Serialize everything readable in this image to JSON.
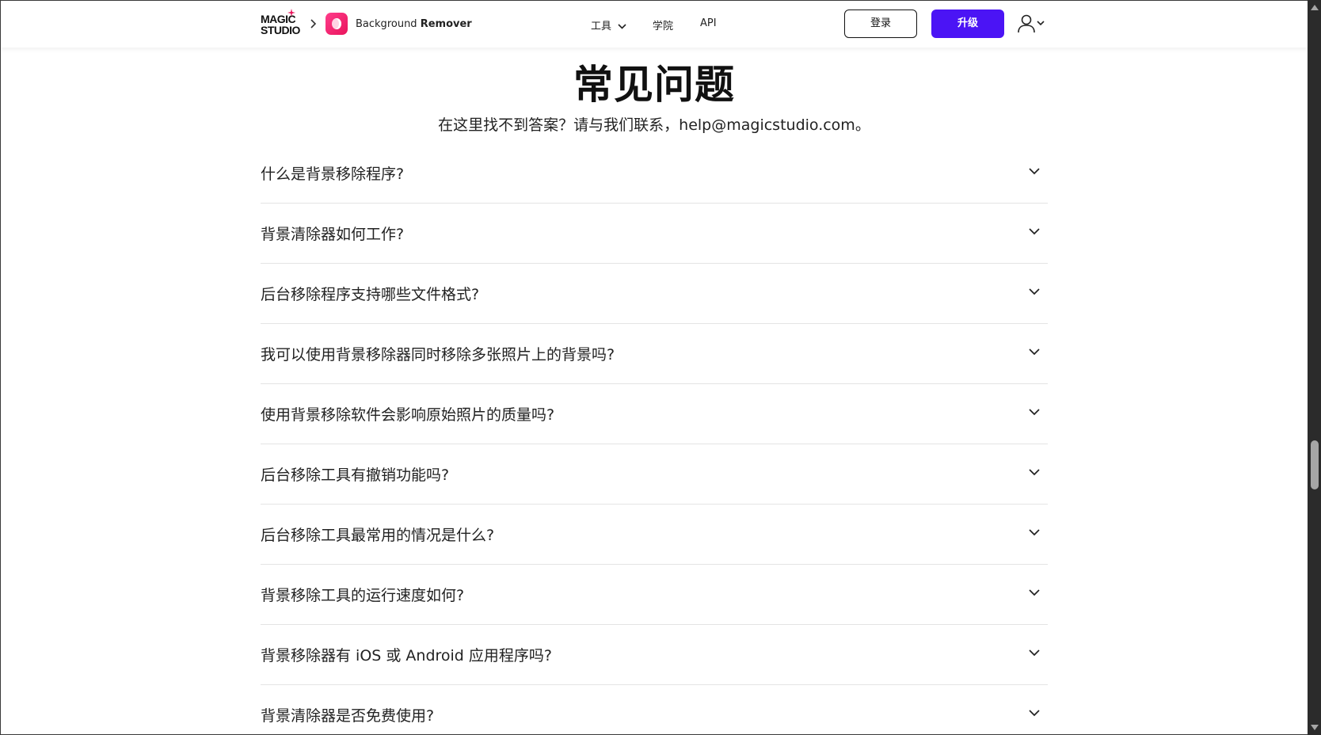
{
  "header": {
    "logo_line1": "MAGIC",
    "logo_line2": "STUDIO",
    "app_name_prefix": "Background ",
    "app_name_bold": "Remover",
    "nav": {
      "tools": "工具",
      "academy": "学院",
      "api": "API"
    },
    "login_label": "登录",
    "upgrade_label": "升级"
  },
  "faq": {
    "title": "常见问题",
    "subtitle": "在这里找不到答案？请与我们联系，help@magicstudio.com。",
    "items": [
      {
        "question": "什么是背景移除程序?"
      },
      {
        "question": "背景清除器如何工作?"
      },
      {
        "question": "后台移除程序支持哪些文件格式?"
      },
      {
        "question": "我可以使用背景移除器同时移除多张照片上的背景吗?"
      },
      {
        "question": "使用背景移除软件会影响原始照片的质量吗?"
      },
      {
        "question": "后台移除工具有撤销功能吗?"
      },
      {
        "question": "后台移除工具最常用的情况是什么?"
      },
      {
        "question": "背景移除工具的运行速度如何?"
      },
      {
        "question": "背景移除器有 iOS 或 Android 应用程序吗?"
      },
      {
        "question": "背景清除器是否免费使用?"
      }
    ]
  },
  "icons": {
    "breadcrumb": "chevron-right-icon",
    "app": "background-remover-app-icon",
    "dropdown": "chevron-down-icon",
    "user": "user-icon",
    "faq_toggle": "chevron-down-icon"
  },
  "colors": {
    "accent": "#4b14f5",
    "app_icon": "#ff3d8b",
    "divider": "#e4e4e4",
    "text": "#111111"
  }
}
